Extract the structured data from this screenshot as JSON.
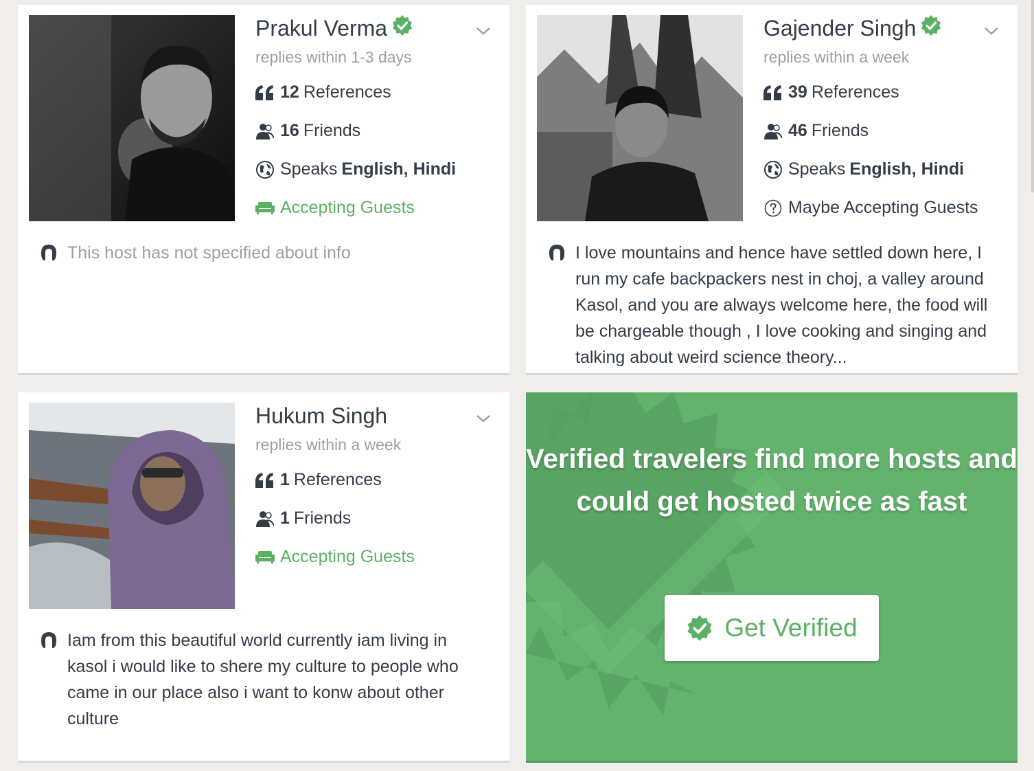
{
  "hosts": [
    {
      "name": "Prakul Verma",
      "verified": true,
      "reply_time": "replies within 1-3 days",
      "references_count": "12",
      "references_label": "References",
      "friends_count": "16",
      "friends_label": "Friends",
      "speaks_prefix": "Speaks",
      "languages": "English, Hindi",
      "status": "Accepting Guests",
      "about": "This host has not specified about info"
    },
    {
      "name": "Gajender Singh",
      "verified": true,
      "reply_time": "replies within a week",
      "references_count": "39",
      "references_label": "References",
      "friends_count": "46",
      "friends_label": "Friends",
      "speaks_prefix": "Speaks",
      "languages": "English, Hindi",
      "status": "Maybe Accepting Guests",
      "about": "I love mountains and hence have settled down here, I run my cafe backpackers nest in choj, a valley around Kasol, and you are always welcome here, the food will be chargeable though , I love cooking and singing and talking about weird science theory..."
    },
    {
      "name": "Hukum Singh",
      "verified": false,
      "reply_time": "replies within a week",
      "references_count": "1",
      "references_label": "References",
      "friends_count": "1",
      "friends_label": "Friends",
      "status": "Accepting Guests",
      "about": "Iam from this beautiful world currently iam living in kasol i would like to shere my culture to people who came in our place also i want to konw about other culture"
    }
  ],
  "promo": {
    "headline": "Verified travelers find more hosts and could get hosted twice as fast",
    "button_label": "Get Verified"
  },
  "colors": {
    "accent_green": "#5bb064",
    "promo_bg": "#63b36c",
    "muted_text": "#9aa0a6",
    "text": "#333c47",
    "page_bg": "#efeeea"
  }
}
